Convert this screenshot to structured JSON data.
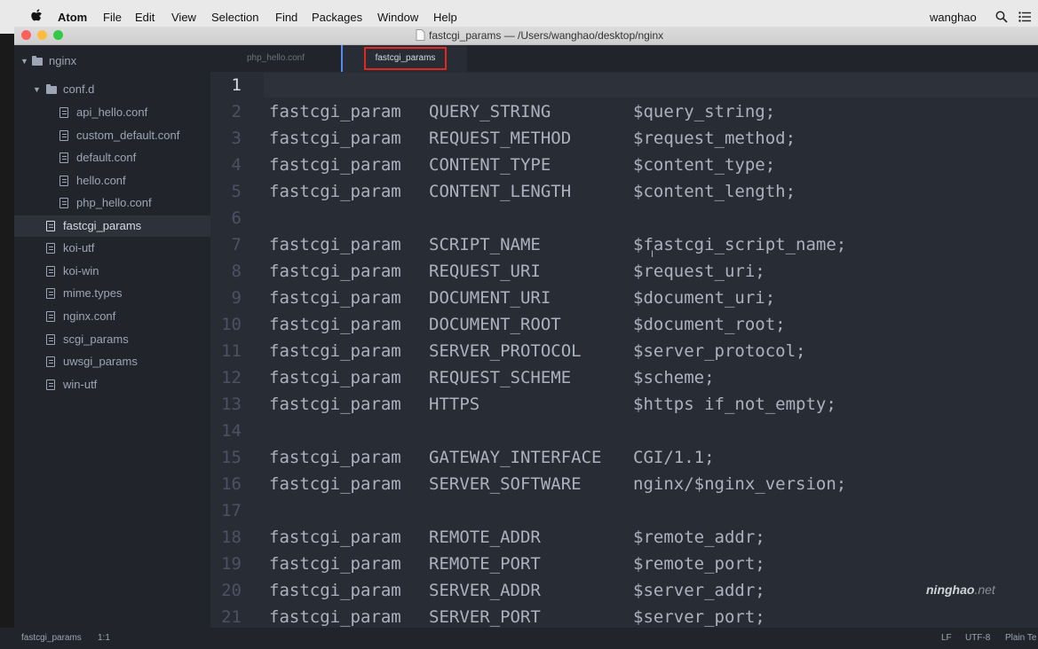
{
  "menubar": {
    "app_name": "Atom",
    "menus": [
      "File",
      "Edit",
      "View",
      "Selection",
      "Find",
      "Packages",
      "Window",
      "Help"
    ],
    "user": "wanghao"
  },
  "window": {
    "title": "fastcgi_params — /Users/wanghao/desktop/nginx",
    "traffic_lights": {
      "close": "#fc605c",
      "minimize": "#fdbc40",
      "zoom": "#34c84a"
    }
  },
  "tree": {
    "root": "nginx",
    "folder": "conf.d",
    "folder_files": [
      "api_hello.conf",
      "custom_default.conf",
      "default.conf",
      "hello.conf",
      "php_hello.conf"
    ],
    "files": [
      "fastcgi_params",
      "koi-utf",
      "koi-win",
      "mime.types",
      "nginx.conf",
      "scgi_params",
      "uwsgi_params",
      "win-utf"
    ],
    "selected": "fastcgi_params"
  },
  "tabs": [
    {
      "label": "php_hello.conf",
      "active": false
    },
    {
      "label": "fastcgi_params",
      "active": true
    }
  ],
  "editor": {
    "current_line": 1,
    "lines": [
      {
        "n": "1",
        "directive": "",
        "name": "",
        "value": ""
      },
      {
        "n": "2",
        "directive": "fastcgi_param",
        "name": "QUERY_STRING",
        "value": "$query_string;"
      },
      {
        "n": "3",
        "directive": "fastcgi_param",
        "name": "REQUEST_METHOD",
        "value": "$request_method;"
      },
      {
        "n": "4",
        "directive": "fastcgi_param",
        "name": "CONTENT_TYPE",
        "value": "$content_type;"
      },
      {
        "n": "5",
        "directive": "fastcgi_param",
        "name": "CONTENT_LENGTH",
        "value": "$content_length;"
      },
      {
        "n": "6",
        "directive": "",
        "name": "",
        "value": ""
      },
      {
        "n": "7",
        "directive": "fastcgi_param",
        "name": "SCRIPT_NAME",
        "value": "$fastcgi_script_name;"
      },
      {
        "n": "8",
        "directive": "fastcgi_param",
        "name": "REQUEST_URI",
        "value": "$request_uri;"
      },
      {
        "n": "9",
        "directive": "fastcgi_param",
        "name": "DOCUMENT_URI",
        "value": "$document_uri;"
      },
      {
        "n": "10",
        "directive": "fastcgi_param",
        "name": "DOCUMENT_ROOT",
        "value": "$document_root;"
      },
      {
        "n": "11",
        "directive": "fastcgi_param",
        "name": "SERVER_PROTOCOL",
        "value": "$server_protocol;"
      },
      {
        "n": "12",
        "directive": "fastcgi_param",
        "name": "REQUEST_SCHEME",
        "value": "$scheme;"
      },
      {
        "n": "13",
        "directive": "fastcgi_param",
        "name": "HTTPS",
        "value": "$https if_not_empty;"
      },
      {
        "n": "14",
        "directive": "",
        "name": "",
        "value": ""
      },
      {
        "n": "15",
        "directive": "fastcgi_param",
        "name": "GATEWAY_INTERFACE",
        "value": "CGI/1.1;"
      },
      {
        "n": "16",
        "directive": "fastcgi_param",
        "name": "SERVER_SOFTWARE",
        "value": "nginx/$nginx_version;"
      },
      {
        "n": "17",
        "directive": "",
        "name": "",
        "value": ""
      },
      {
        "n": "18",
        "directive": "fastcgi_param",
        "name": "REMOTE_ADDR",
        "value": "$remote_addr;"
      },
      {
        "n": "19",
        "directive": "fastcgi_param",
        "name": "REMOTE_PORT",
        "value": "$remote_port;"
      },
      {
        "n": "20",
        "directive": "fastcgi_param",
        "name": "SERVER_ADDR",
        "value": "$server_addr;"
      },
      {
        "n": "21",
        "directive": "fastcgi_param",
        "name": "SERVER_PORT",
        "value": "$server_port;"
      }
    ]
  },
  "watermark": {
    "brand": "ninghao",
    "suffix": ".net"
  },
  "statusbar": {
    "file": "fastcgi_params",
    "cursor": "1:1",
    "line_ending": "LF",
    "encoding": "UTF-8",
    "grammar": "Plain Te"
  },
  "colors": {
    "editor_bg": "#282c34",
    "sidebar_bg": "#21252b",
    "tab_highlight": "#e2271f",
    "accent": "#568af2"
  }
}
